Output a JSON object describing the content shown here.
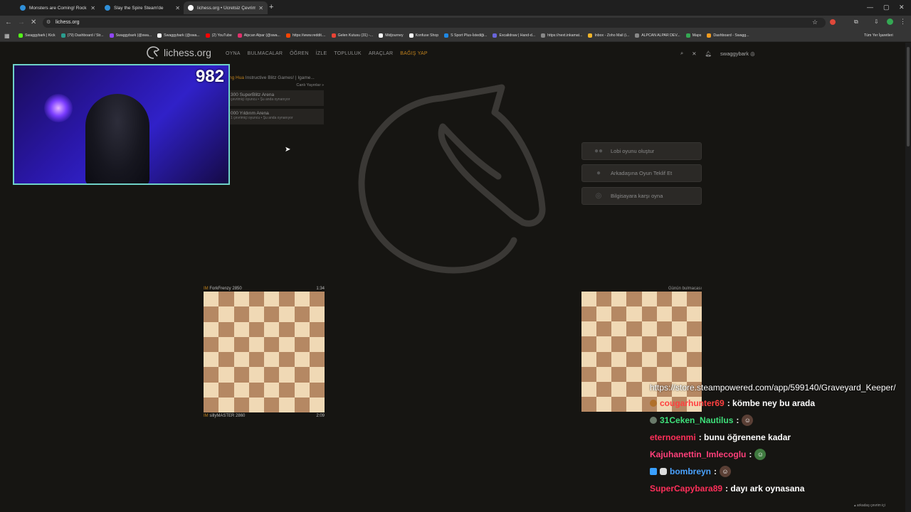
{
  "browser": {
    "tabs": [
      {
        "title": "Monsters are Coming! Rock & ...",
        "active": false,
        "color": "#2f8fd8"
      },
      {
        "title": "Slay the Spire Steam'de",
        "active": false,
        "color": "#2f8fd8"
      },
      {
        "title": "lichess.org • Ücretsiz Çevrimiçi",
        "active": true,
        "color": "#ffffff"
      }
    ],
    "new_tab_icon": "plus-icon",
    "url": "lichess.org",
    "bookmarks": [
      {
        "label": "Swaggybark | Kick",
        "color": "#53fc18"
      },
      {
        "label": "(79) Dashboard / Str...",
        "color": "#2a9d8f"
      },
      {
        "label": "Swaggybark (@swa...",
        "color": "#9146ff"
      },
      {
        "label": "Swaggybark (@swa...",
        "color": "#ffffff"
      },
      {
        "label": "(2) YouTube",
        "color": "#ff0000"
      },
      {
        "label": "Alpcan Alpar (@swa...",
        "color": "#e1306c"
      },
      {
        "label": "https://www.reddit....",
        "color": "#ff4500"
      },
      {
        "label": "Gelen Kutusu (31) -...",
        "color": "#ea4335"
      },
      {
        "label": "Midjourney",
        "color": "#ffffff"
      },
      {
        "label": "Konfuse Shop",
        "color": "#ffffff"
      },
      {
        "label": "S Sport Plus-İstediği...",
        "color": "#1e88e5"
      },
      {
        "label": "Excalidraw | Hand-d...",
        "color": "#6965db"
      },
      {
        "label": "https://next.inkamat...",
        "color": "#888888"
      },
      {
        "label": "Inbox - Zoho Mail (i...",
        "color": "#f0b429"
      },
      {
        "label": "ALPCAN ALPAR DEV...",
        "color": "#888888"
      },
      {
        "label": "Maps",
        "color": "#34a853"
      },
      {
        "label": "Dashboard - Swagg...",
        "color": "#f29c1f"
      }
    ],
    "all_bookmarks_label": "Tüm Yer İşaretleri"
  },
  "lichess": {
    "logo_text": "lichess.org",
    "nav": [
      "OYNA",
      "BULMACALAR",
      "ÖĞREN",
      "İZLE",
      "TOPLULUK",
      "ARAÇLAR",
      "BAĞIŞ YAP"
    ],
    "username": "swaggybark",
    "stream": {
      "name": "ng Hua",
      "title": "Instructive Blitz Games! | Igame..."
    },
    "live_streamers_link": "Canlı Yayınlar »",
    "tournaments": [
      {
        "name": "300 SuperBlitz Arena",
        "info": "çevrimiçi oyuncu • Şu anda oynanıyor"
      },
      {
        "name": "000 Yıldırım Arena",
        "info": "1 çevrimiçi oyuncu • Şu anda oynanıyor"
      }
    ],
    "lobby_buttons": [
      "Lobi oyunu oluştur",
      "Arkadaşına Oyun Teklif Et",
      "Bilgisayara karşı oyna"
    ],
    "tv": {
      "top_player": {
        "title": "IM",
        "name": "ForkFrenzy",
        "rating": "2850",
        "clock": "1:34"
      },
      "bottom_player": {
        "title": "IM",
        "name": "sillyMASTER",
        "rating": "2860",
        "clock": "2:09"
      }
    },
    "puzzle_label": "Günün bulmacası",
    "friends_label": "arkadaş çevrim içi"
  },
  "webcam": {
    "viewer_count": "982"
  },
  "stream_chat": {
    "link": "https://store.steampowered.com/app/599140/Graveyard_Keeper/",
    "messages": [
      {
        "user": "cougarhunter69",
        "text": ": kömbe ney bu arada",
        "color": "#ff4040"
      },
      {
        "user": "31Ceken_Nautilus",
        "text": ":",
        "color": "#3ee07a"
      },
      {
        "user": "eternoenmi",
        "text": ": bunu öğrenene kadar",
        "color": "#ff2f5a"
      },
      {
        "user": "Kajuhanettin_Imlecoglu",
        "text": ":",
        "color": "#ff3f7a"
      },
      {
        "user": "bombreyn",
        "text": ":",
        "color": "#4aa3ff"
      },
      {
        "user": "SuperCapybara89",
        "text": ": dayı ark oynasana",
        "color": "#ff2f5a"
      }
    ]
  }
}
